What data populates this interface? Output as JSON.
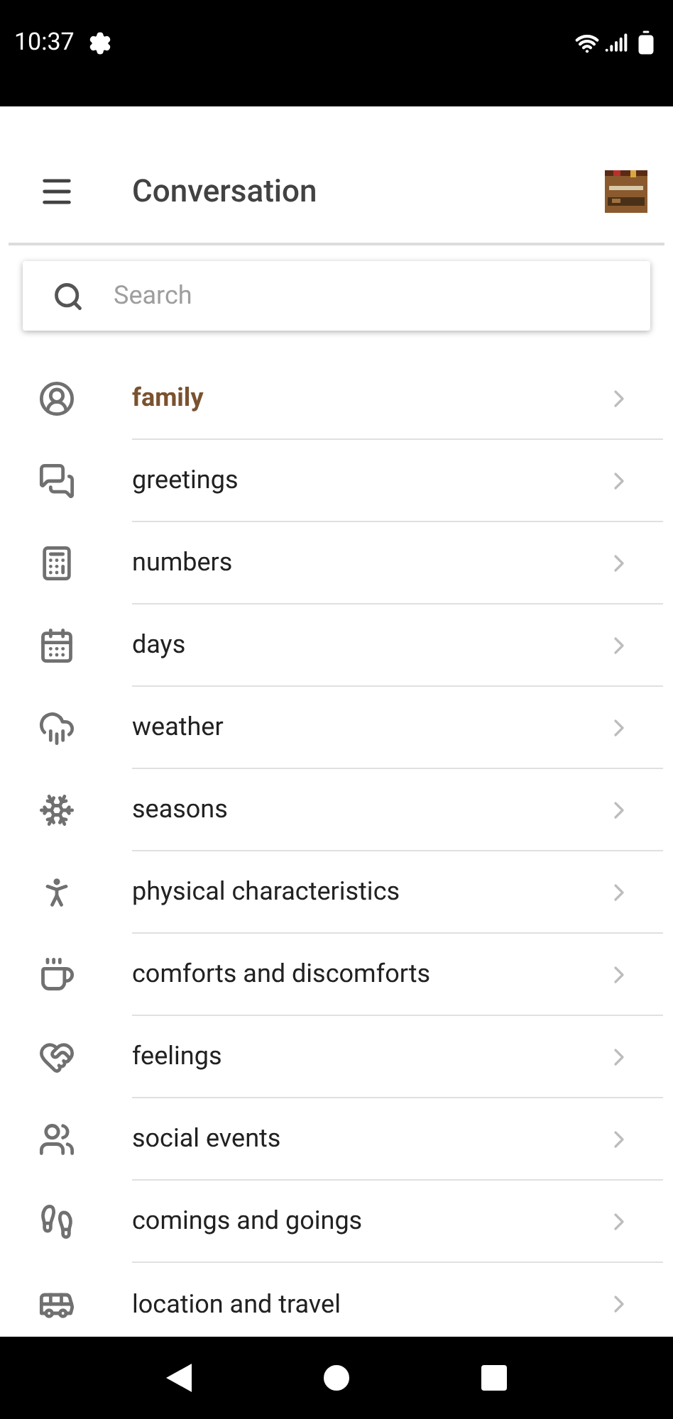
{
  "status_bar": {
    "time": "10:37"
  },
  "app_bar": {
    "title": "Conversation"
  },
  "search": {
    "placeholder": "Search"
  },
  "topics": [
    {
      "label": "family",
      "selected": true
    },
    {
      "label": "greetings",
      "selected": false
    },
    {
      "label": "numbers",
      "selected": false
    },
    {
      "label": "days",
      "selected": false
    },
    {
      "label": "weather",
      "selected": false
    },
    {
      "label": "seasons",
      "selected": false
    },
    {
      "label": "physical characteristics",
      "selected": false
    },
    {
      "label": "comforts and discomforts",
      "selected": false
    },
    {
      "label": "feelings",
      "selected": false
    },
    {
      "label": "social events",
      "selected": false
    },
    {
      "label": "comings and goings",
      "selected": false
    },
    {
      "label": "location and travel",
      "selected": false
    }
  ]
}
